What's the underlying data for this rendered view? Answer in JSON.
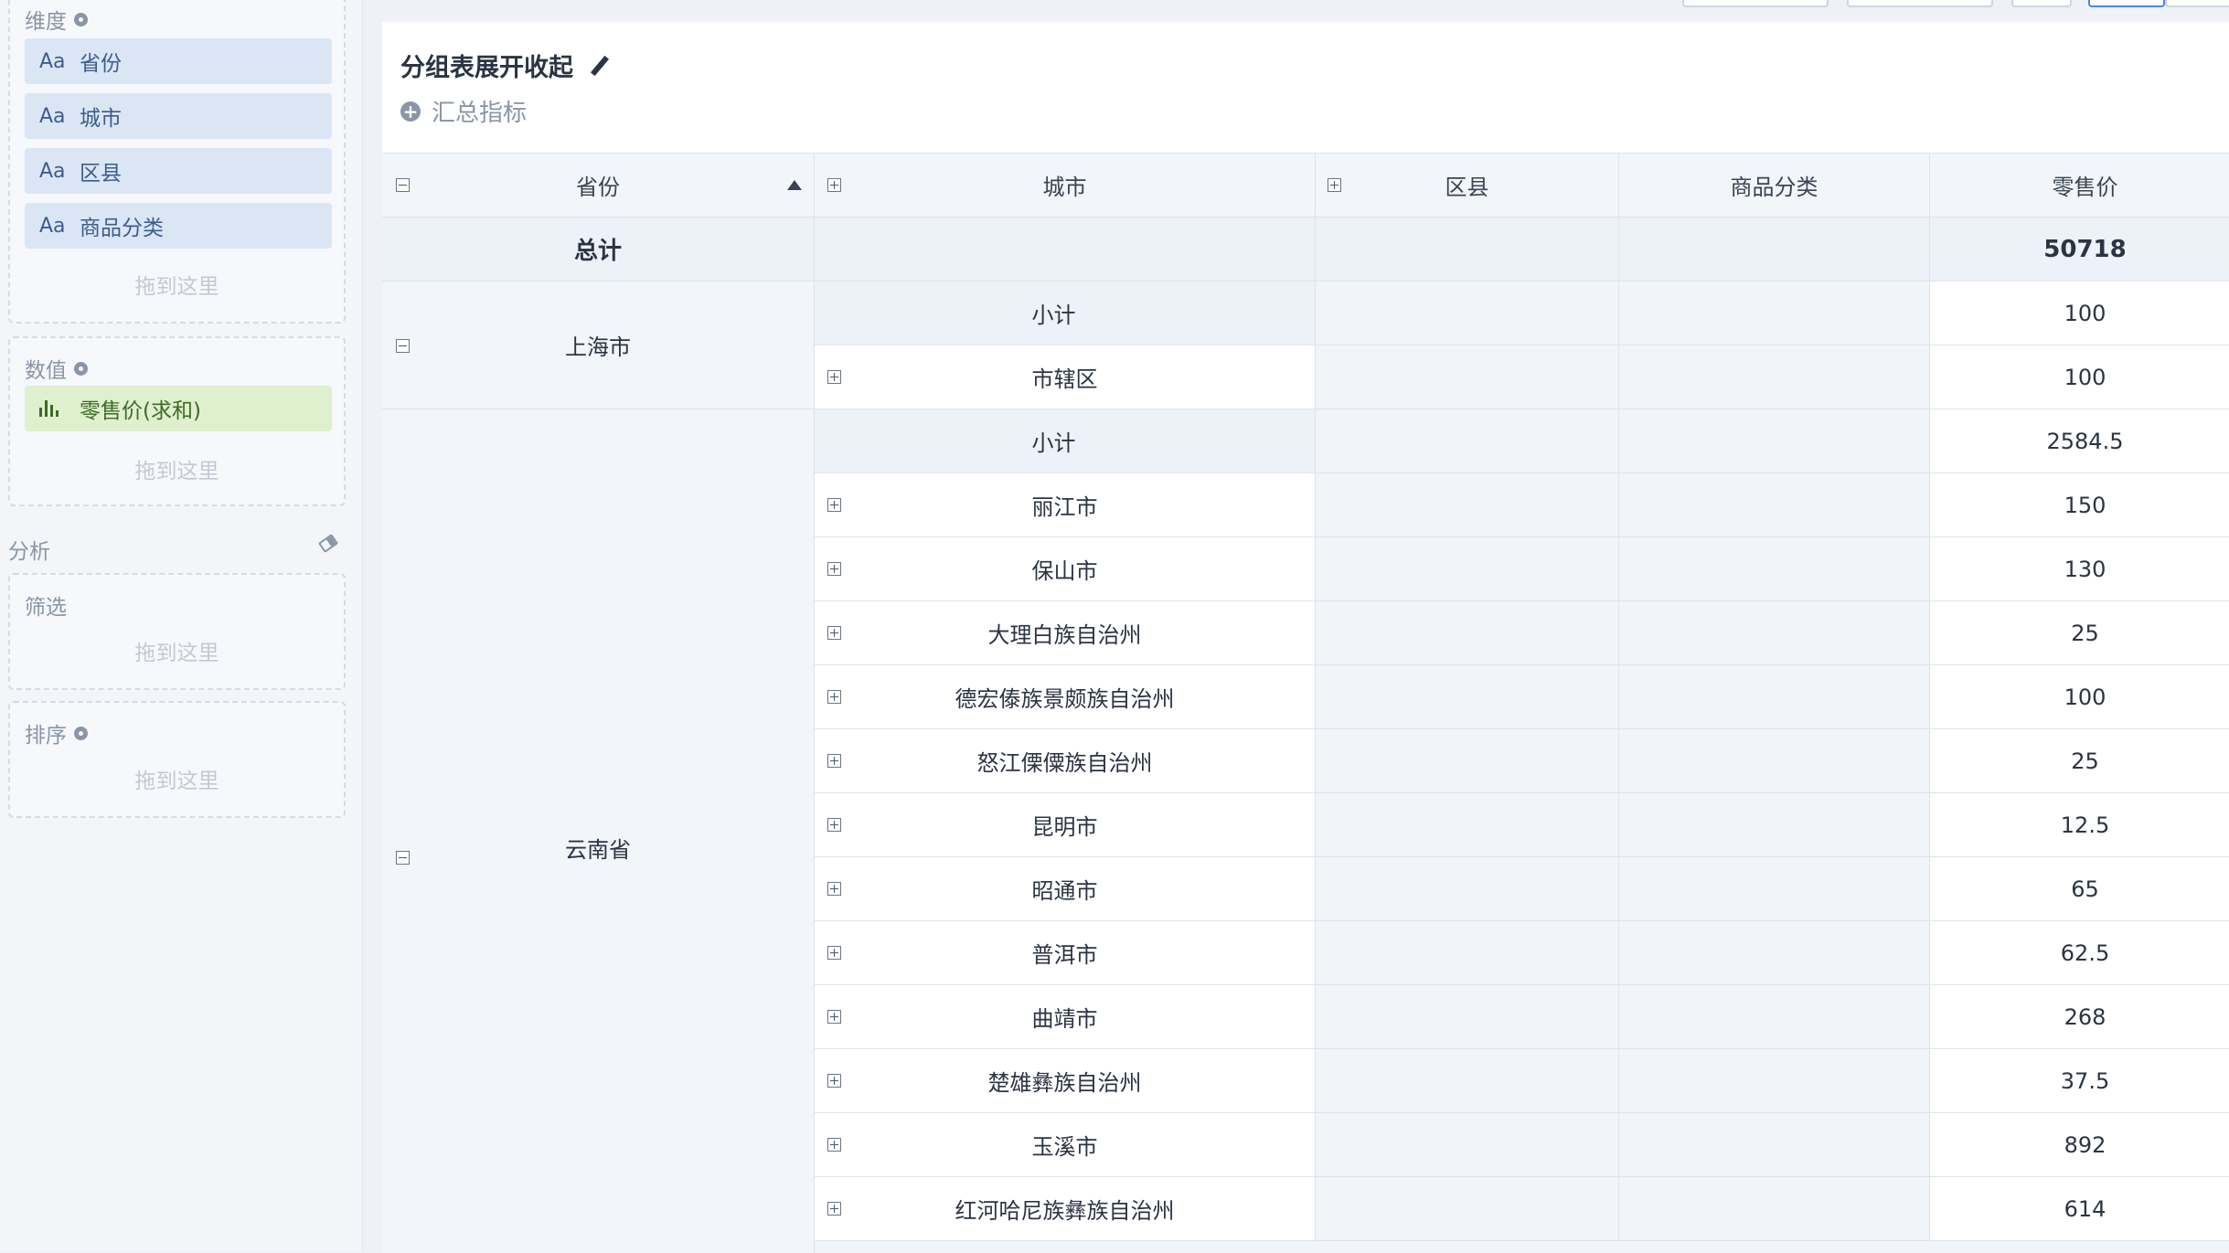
{
  "left_panel": {
    "dimensions": {
      "title": "维度",
      "fields": [
        {
          "type": "Aa",
          "label": "省份"
        },
        {
          "type": "Aa",
          "label": "城市"
        },
        {
          "type": "Aa",
          "label": "区县"
        },
        {
          "type": "Aa",
          "label": "商品分类"
        }
      ],
      "drop_hint": "拖到这里"
    },
    "values": {
      "title": "数值",
      "fields": [
        {
          "type": "bar-chart-icon",
          "label": "零售价(求和)"
        }
      ],
      "drop_hint": "拖到这里"
    },
    "analysis": {
      "label": "分析",
      "filter": {
        "title": "筛选",
        "drop_hint": "拖到这里"
      },
      "sort": {
        "title": "排序",
        "drop_hint": "拖到这里"
      }
    }
  },
  "chart": {
    "title": "分组表展开收起",
    "add_metric": "汇总指标"
  },
  "table": {
    "headers": [
      "省份",
      "城市",
      "区县",
      "商品分类",
      "零售价"
    ],
    "total": {
      "label": "总计",
      "value": "50718"
    },
    "groups": [
      {
        "province": "上海市",
        "rows": [
          {
            "city": "小计",
            "value": "100",
            "subtotal": true
          },
          {
            "city": "市辖区",
            "value": "100"
          }
        ]
      },
      {
        "province": "云南省",
        "rows": [
          {
            "city": "小计",
            "value": "2584.5",
            "subtotal": true
          },
          {
            "city": "丽江市",
            "value": "150"
          },
          {
            "city": "保山市",
            "value": "130"
          },
          {
            "city": "大理白族自治州",
            "value": "25"
          },
          {
            "city": "德宏傣族景颇族自治州",
            "value": "100"
          },
          {
            "city": "怒江傈僳族自治州",
            "value": "25"
          },
          {
            "city": "昆明市",
            "value": "12.5"
          },
          {
            "city": "昭通市",
            "value": "65"
          },
          {
            "city": "普洱市",
            "value": "62.5"
          },
          {
            "city": "曲靖市",
            "value": "268"
          },
          {
            "city": "楚雄彝族自治州",
            "value": "37.5"
          },
          {
            "city": "玉溪市",
            "value": "892"
          },
          {
            "city": "红河哈尼族彝族自治州",
            "value": "614"
          }
        ]
      }
    ]
  }
}
